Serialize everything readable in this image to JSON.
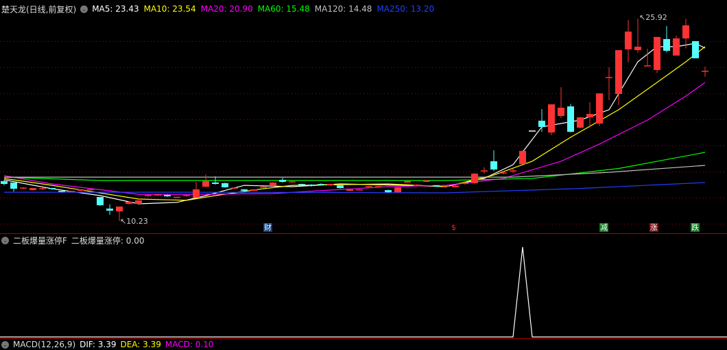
{
  "header": {
    "title": "楚天龙(日线,前复权)",
    "ma": [
      {
        "label": "MA5: 23.43",
        "color": "#ffffff"
      },
      {
        "label": "MA10: 23.54",
        "color": "#ffff00"
      },
      {
        "label": "MA20: 20.90",
        "color": "#ff00ff"
      },
      {
        "label": "MA60: 15.48",
        "color": "#00ff00"
      },
      {
        "label": "MA120: 14.48",
        "color": "#c0c0c0"
      },
      {
        "label": "MA250: 13.20",
        "color": "#2040ff"
      }
    ]
  },
  "indicator": {
    "name": "二板爆量涨停F",
    "value_label": "二板爆量涨停: 0.00"
  },
  "macd": {
    "name": "MACD(12,26,9)",
    "items": [
      {
        "label": "DIF: 3.39",
        "color": "#ffffff"
      },
      {
        "label": "DEA: 3.39",
        "color": "#ffff00"
      },
      {
        "label": "MACD: 0.10",
        "color": "#ff00ff"
      }
    ]
  },
  "chart_data": {
    "type": "candlestick",
    "colors": {
      "up": "#ff3333",
      "down": "#55ffff",
      "grid": "#aa0000"
    },
    "price_range": [
      10.23,
      25.92
    ],
    "high_label": {
      "text": "25.92",
      "index": 66
    },
    "low_label": {
      "text": "10.23",
      "index": 12
    },
    "candles": [
      [
        13.32,
        13.1,
        13.4,
        13.0
      ],
      [
        13.21,
        12.73,
        13.21,
        12.52
      ],
      [
        12.78,
        12.78,
        12.85,
        12.7
      ],
      [
        12.62,
        12.78,
        12.8,
        12.6
      ],
      [
        12.73,
        12.73,
        12.85,
        12.62
      ],
      [
        12.74,
        12.73,
        12.8,
        12.65
      ],
      [
        12.57,
        12.5,
        12.57,
        12.45
      ],
      [
        12.52,
        12.52,
        12.58,
        12.46
      ],
      [
        12.57,
        12.68,
        12.7,
        12.55
      ],
      [
        12.64,
        12.7,
        12.72,
        12.62
      ],
      [
        12.09,
        11.45,
        12.09,
        11.4
      ],
      [
        11.19,
        11.03,
        11.51,
        10.71
      ],
      [
        10.97,
        11.35,
        11.35,
        10.23
      ],
      [
        11.56,
        11.72,
        11.75,
        11.5
      ],
      [
        11.56,
        11.83,
        11.85,
        11.5
      ],
      [
        12.2,
        12.2,
        12.28,
        12.12
      ],
      [
        12.25,
        12.25,
        12.32,
        12.18
      ],
      [
        12.25,
        12.14,
        12.28,
        12.1
      ],
      [
        12.04,
        12.1,
        12.12,
        12.0
      ],
      [
        12.2,
        12.2,
        12.27,
        12.12
      ],
      [
        12.04,
        12.68,
        13.26,
        12.0
      ],
      [
        12.89,
        13.32,
        13.85,
        12.85
      ],
      [
        13.21,
        13.1,
        13.69,
        13.05
      ],
      [
        13.16,
        12.84,
        13.2,
        12.8
      ],
      [
        12.78,
        12.78,
        12.85,
        12.7
      ],
      [
        12.68,
        12.57,
        12.7,
        12.52
      ],
      [
        12.57,
        12.68,
        12.7,
        12.55
      ],
      [
        12.84,
        12.89,
        12.92,
        12.8
      ],
      [
        12.94,
        13.21,
        13.25,
        12.9
      ],
      [
        13.42,
        13.26,
        13.58,
        13.2
      ],
      [
        13.26,
        13.3,
        13.35,
        13.2
      ],
      [
        13.1,
        13.05,
        13.12,
        13.0
      ],
      [
        13.05,
        12.94,
        13.08,
        12.9
      ],
      [
        13.1,
        13.05,
        13.15,
        13.0
      ],
      [
        12.99,
        13.1,
        13.12,
        12.95
      ],
      [
        12.99,
        12.78,
        13.0,
        12.75
      ],
      [
        12.57,
        12.68,
        12.7,
        12.55
      ],
      [
        12.62,
        12.68,
        12.7,
        12.6
      ],
      [
        12.89,
        12.89,
        12.95,
        12.82
      ],
      [
        12.89,
        12.89,
        12.95,
        12.82
      ],
      [
        12.62,
        12.46,
        12.65,
        12.42
      ],
      [
        12.46,
        12.84,
        12.86,
        12.44
      ],
      [
        13.21,
        13.32,
        13.35,
        13.18
      ],
      [
        12.94,
        13.05,
        13.08,
        12.9
      ],
      [
        13.26,
        13.37,
        13.4,
        13.22
      ],
      [
        13.0,
        12.9,
        13.02,
        12.88
      ],
      [
        12.9,
        13.0,
        13.02,
        12.88
      ],
      [
        12.85,
        12.95,
        12.98,
        12.82
      ],
      [
        13.1,
        13.2,
        13.25,
        13.05
      ],
      [
        13.16,
        13.9,
        13.95,
        13.12
      ],
      [
        14.11,
        14.11,
        14.4,
        13.9
      ],
      [
        14.86,
        14.22,
        15.71,
        14.1
      ],
      [
        13.95,
        13.95,
        14.1,
        13.85
      ],
      [
        14.11,
        14.11,
        14.3,
        13.95
      ],
      [
        14.64,
        15.66,
        15.7,
        14.6
      ],
      [
        17.2,
        17.2,
        17.2,
        17.2
      ],
      [
        18.0,
        17.52,
        18.9,
        17.14
      ],
      [
        17.09,
        19.27,
        19.27,
        16.88
      ],
      [
        18.37,
        19.01,
        20.6,
        18.21
      ],
      [
        19.11,
        17.14,
        19.3,
        17.1
      ],
      [
        17.46,
        18.26,
        18.3,
        17.4
      ],
      [
        18.26,
        18.52,
        19.43,
        17.46
      ],
      [
        17.78,
        20.12,
        20.12,
        17.6
      ],
      [
        21.35,
        21.35,
        22.15,
        19.59
      ],
      [
        20.07,
        23.47,
        23.47,
        19.22
      ],
      [
        23.53,
        24.91,
        25.8,
        22.52
      ],
      [
        23.47,
        23.74,
        25.92,
        23.26
      ],
      [
        22.25,
        22.25,
        23.58,
        22.25
      ],
      [
        21.93,
        24.49,
        24.5,
        21.7
      ],
      [
        24.33,
        23.42,
        25.34,
        23.3
      ],
      [
        23.05,
        24.38,
        24.6,
        23.05
      ],
      [
        24.38,
        25.39,
        25.9,
        23.6
      ],
      [
        24.17,
        22.84,
        24.17,
        22.84
      ],
      [
        21.83,
        21.83,
        22.2,
        21.4
      ]
    ],
    "ma_lines": [
      {
        "name": "MA5",
        "color": "#ffffff",
        "points": [
          [
            0,
            13.42
          ],
          [
            5,
            12.73
          ],
          [
            10,
            12.2
          ],
          [
            14,
            11.56
          ],
          [
            18,
            11.67
          ],
          [
            21,
            12.2
          ],
          [
            25,
            12.99
          ],
          [
            30,
            12.89
          ],
          [
            35,
            13.1
          ],
          [
            42,
            12.99
          ],
          [
            46,
            12.89
          ],
          [
            50,
            13.53
          ],
          [
            53,
            14.59
          ],
          [
            56,
            17.52
          ],
          [
            60,
            18.05
          ],
          [
            63,
            18.85
          ],
          [
            66,
            22.57
          ],
          [
            68,
            23.74
          ],
          [
            70,
            23.74
          ],
          [
            72,
            24.0
          ],
          [
            73,
            23.63
          ]
        ]
      },
      {
        "name": "MA10",
        "color": "#ffff00",
        "points": [
          [
            0,
            13.53
          ],
          [
            5,
            12.99
          ],
          [
            14,
            11.93
          ],
          [
            19,
            11.83
          ],
          [
            22,
            12.2
          ],
          [
            27,
            12.73
          ],
          [
            30,
            12.99
          ],
          [
            40,
            13.1
          ],
          [
            46,
            12.89
          ],
          [
            51,
            13.79
          ],
          [
            55,
            14.86
          ],
          [
            59,
            16.72
          ],
          [
            64,
            18.85
          ],
          [
            68,
            20.97
          ],
          [
            71,
            22.57
          ],
          [
            73,
            23.74
          ]
        ]
      },
      {
        "name": "MA20",
        "color": "#ff00ff",
        "points": [
          [
            0,
            13.74
          ],
          [
            5,
            13.1
          ],
          [
            14,
            12.3
          ],
          [
            20,
            12.3
          ],
          [
            28,
            12.36
          ],
          [
            40,
            12.89
          ],
          [
            46,
            12.99
          ],
          [
            52,
            13.53
          ],
          [
            58,
            14.86
          ],
          [
            62,
            16.19
          ],
          [
            67,
            18.05
          ],
          [
            71,
            19.91
          ],
          [
            73,
            20.97
          ]
        ]
      },
      {
        "name": "MA60",
        "color": "#00ff00",
        "points": [
          [
            0,
            13.63
          ],
          [
            10,
            13.37
          ],
          [
            46,
            13.37
          ],
          [
            55,
            13.53
          ],
          [
            64,
            14.3
          ],
          [
            73,
            15.55
          ]
        ]
      },
      {
        "name": "MA120",
        "color": "#c0c0c0",
        "points": [
          [
            0,
            13.63
          ],
          [
            53,
            13.63
          ],
          [
            63,
            14.0
          ],
          [
            73,
            14.54
          ]
        ]
      },
      {
        "name": "MA250",
        "color": "#2040ff",
        "points": [
          [
            0,
            12.46
          ],
          [
            20,
            12.46
          ],
          [
            46,
            12.41
          ],
          [
            60,
            12.75
          ],
          [
            73,
            13.21
          ]
        ]
      }
    ],
    "signals": [
      {
        "text": "财",
        "index": 27.5,
        "bg": "#0a3d7a",
        "fg": "#ffffff"
      },
      {
        "text": "$",
        "index": 47,
        "bg": "transparent",
        "fg": "#ff2020"
      },
      {
        "text": "减",
        "index": 62.5,
        "bg": "#0a7a1a",
        "fg": "#ffffff"
      },
      {
        "text": "涨",
        "index": 67.7,
        "bg": "#7a0a0a",
        "fg": "#ffffff"
      },
      {
        "text": "跌",
        "index": 72,
        "bg": "#0a7a1a",
        "fg": "#ffffff"
      }
    ],
    "indicator_series": {
      "name": "二板爆量涨停",
      "range": [
        0,
        1
      ],
      "spike_index": 54,
      "spike_value": 1
    }
  }
}
